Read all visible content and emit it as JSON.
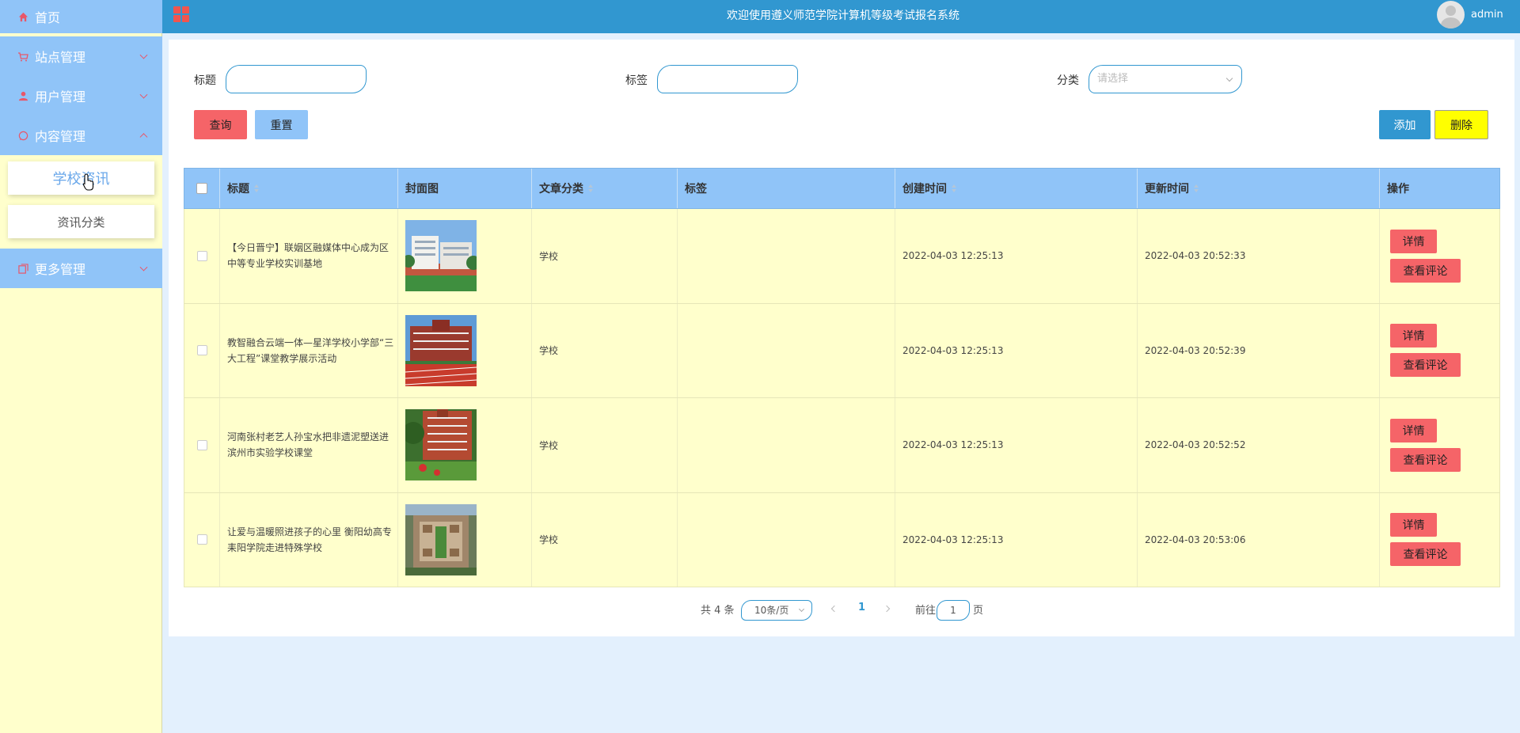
{
  "app": {
    "title": "欢迎使用遵义师范学院计算机等级考试报名系统",
    "username": "admin"
  },
  "sidebar": {
    "items": [
      {
        "label": "首页",
        "icon": "home-icon"
      },
      {
        "label": "站点管理",
        "icon": "cart-icon"
      },
      {
        "label": "用户管理",
        "icon": "user-icon"
      },
      {
        "label": "内容管理",
        "icon": "chat-icon"
      },
      {
        "label": "更多管理",
        "icon": "copy-icon"
      }
    ],
    "submenu": [
      {
        "label": "学校资讯",
        "active": true
      },
      {
        "label": "资讯分类",
        "active": false
      }
    ]
  },
  "filters": {
    "title_label": "标题",
    "tag_label": "标签",
    "category_label": "分类",
    "category_placeholder": "请选择",
    "query_button": "查询",
    "reset_button": "重置",
    "add_button": "添加",
    "delete_button": "删除"
  },
  "table": {
    "headers": [
      "标题",
      "封面图",
      "文章分类",
      "标签",
      "创建时间",
      "更新时间",
      "操作"
    ],
    "rows": [
      {
        "title": "【今日晋宁】联姻区融媒体中心成为区中等专业学校实训基地",
        "category": "学校",
        "tag": "",
        "created": "2022-04-03 12:25:13",
        "updated": "2022-04-03 20:52:33"
      },
      {
        "title": "教智融合云端一体—星洋学校小学部“三大工程”课堂教学展示活动",
        "category": "学校",
        "tag": "",
        "created": "2022-04-03 12:25:13",
        "updated": "2022-04-03 20:52:39"
      },
      {
        "title": "河南张村老艺人孙宝水把非遗泥塑送进滨州市实验学校课堂",
        "category": "学校",
        "tag": "",
        "created": "2022-04-03 12:25:13",
        "updated": "2022-04-03 20:52:52"
      },
      {
        "title": "让爱与温暖照进孩子的心里 衡阳幼高专耒阳学院走进特殊学校",
        "category": "学校",
        "tag": "",
        "created": "2022-04-03 12:25:13",
        "updated": "2022-04-03 20:53:06"
      }
    ],
    "detail_button": "详情",
    "comment_button": "查看评论"
  },
  "pagination": {
    "total": "共 4 条",
    "page_size": "10条/页",
    "current_page": "1",
    "goto_label": "前往",
    "goto_value": "1",
    "page_suffix": "页"
  },
  "colors": {
    "topbar": "#3197d0",
    "sidebar_menu": "#90c4f8",
    "sidebar_bg": "#ffffcc",
    "danger_button": "#f56468",
    "delete_button": "#ffff00"
  }
}
